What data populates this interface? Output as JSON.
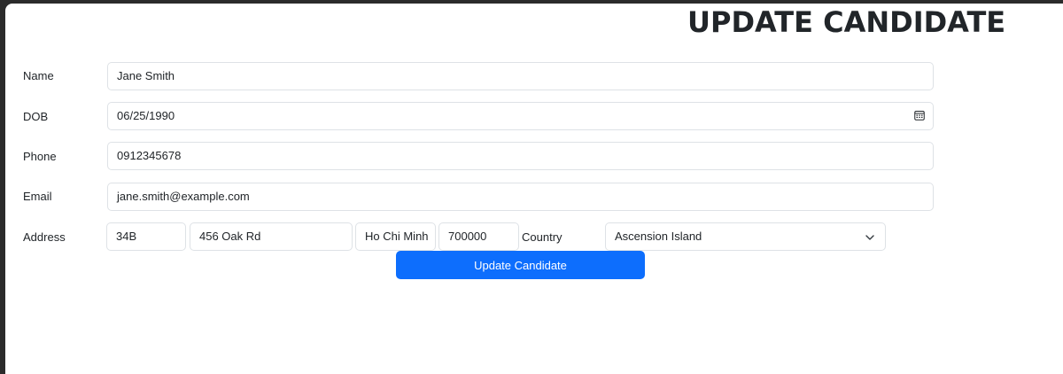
{
  "page": {
    "title": "UPDATE CANDIDATE"
  },
  "form": {
    "name": {
      "label": "Name",
      "value": "Jane Smith"
    },
    "dob": {
      "label": "DOB",
      "value": "06/25/1990",
      "icon": "calendar-icon"
    },
    "phone": {
      "label": "Phone",
      "value": "0912345678"
    },
    "email": {
      "label": "Email",
      "value": "jane.smith@example.com"
    },
    "address": {
      "label": "Address",
      "house_number": "34B",
      "street": "456 Oak Rd",
      "city": "Ho Chi Minh",
      "postal_code": "700000",
      "country_label": "Country",
      "country_selected": "Ascension Island",
      "country_icon": "chevron-down-icon"
    },
    "submit_label": "Update Candidate"
  },
  "colors": {
    "primary": "#0d6efd",
    "border": "#dee2e6",
    "text": "#212529"
  }
}
